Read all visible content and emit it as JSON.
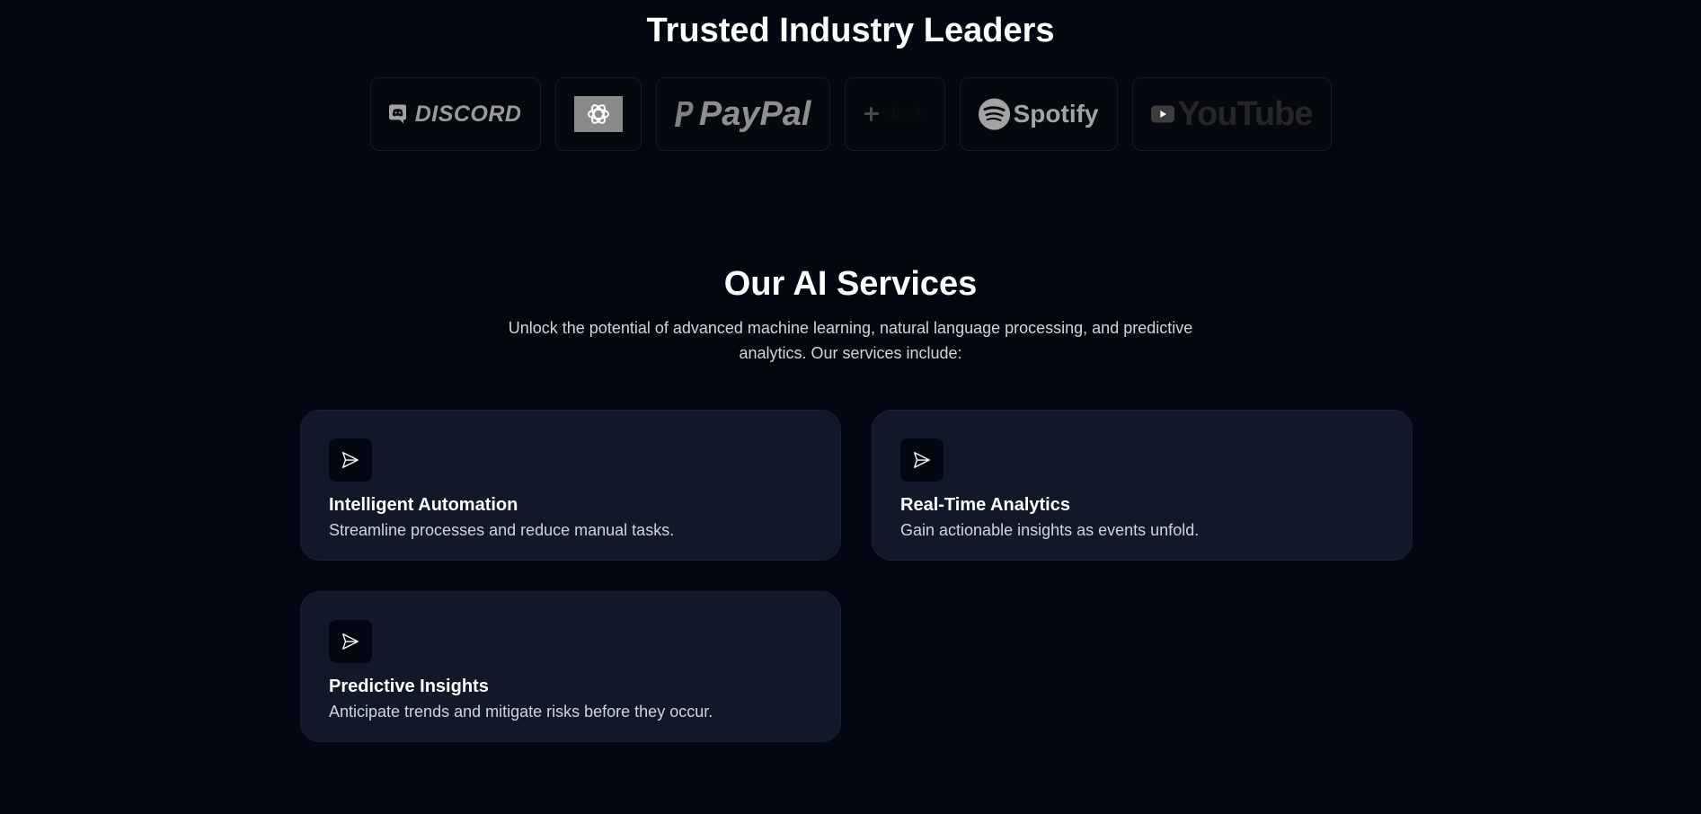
{
  "trusted": {
    "title": "Trusted Industry Leaders",
    "logos": [
      {
        "name": "Discord",
        "text": "DISCORD"
      },
      {
        "name": "OpenAI",
        "text": ""
      },
      {
        "name": "PayPal",
        "text": "PayPal"
      },
      {
        "name": "Slack",
        "text": "slack"
      },
      {
        "name": "Spotify",
        "text": "Spotify"
      },
      {
        "name": "YouTube",
        "text": "YouTube"
      }
    ]
  },
  "services": {
    "title": "Our AI Services",
    "description": "Unlock the potential of advanced machine learning, natural language processing, and predictive analytics. Our services include:",
    "cards": [
      {
        "icon": "send-icon",
        "title": "Intelligent Automation",
        "description": "Streamline processes and reduce manual tasks."
      },
      {
        "icon": "send-icon",
        "title": "Real-Time Analytics",
        "description": "Gain actionable insights as events unfold."
      },
      {
        "icon": "send-icon",
        "title": "Predictive Insights",
        "description": "Anticipate trends and mitigate risks before they occur."
      }
    ]
  },
  "colors": {
    "background": "#030712",
    "card": "#111827",
    "text_muted": "#d1d5db",
    "logo_gray": "#9a9a9a"
  }
}
